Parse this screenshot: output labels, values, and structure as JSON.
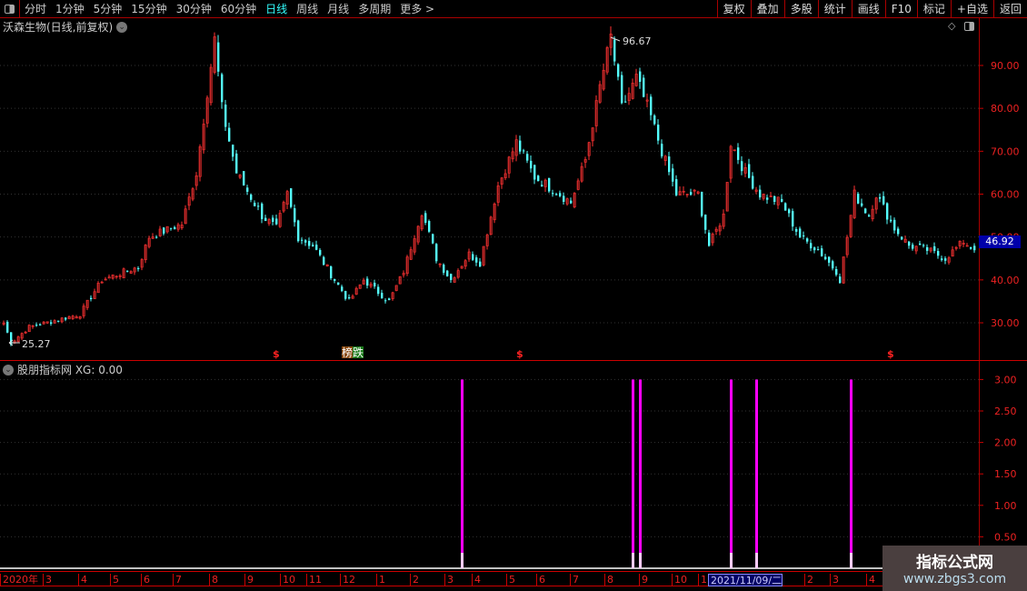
{
  "toolbar": {
    "periods": [
      "分时",
      "1分钟",
      "5分钟",
      "15分钟",
      "30分钟",
      "60分钟",
      "日线",
      "周线",
      "月线",
      "多周期",
      "更多 >"
    ],
    "active": "日线",
    "right_buttons": [
      "复权",
      "叠加",
      "多股",
      "统计",
      "画线",
      "F10",
      "标记",
      "+自选",
      "返回"
    ]
  },
  "stock_title": "沃森生物(日线,前复权)",
  "indicator_title": "股朋指标网 XG: 0.00",
  "last_price_label": "46.92",
  "high_label": "96.67",
  "low_label": "25.27",
  "markers": {
    "drop_label": "榜跌",
    "dollar": "$"
  },
  "watermark": {
    "line1": "指标公式网",
    "line2": "www.zbgs3.com"
  },
  "x_axis_labels": [
    "2020年",
    "3",
    "4",
    "5",
    "6",
    "7",
    "8",
    "9",
    "10",
    "11",
    "12",
    "1",
    "2",
    "3",
    "4",
    "5",
    "6",
    "7",
    "8",
    "9",
    "10",
    "1",
    "2021/11/09/二",
    "2",
    "3",
    "4"
  ],
  "colors": {
    "up": "#ff3232",
    "down": "#54ffff",
    "signal": "#ff00ff",
    "axis": "#cc0000"
  },
  "chart_data": [
    {
      "type": "candlestick",
      "title": "沃森生物(日线,前复权)",
      "y_ticks": [
        "90.00",
        "80.00",
        "70.00",
        "60.00",
        "50.00",
        "40.00",
        "30.00"
      ],
      "ylim": [
        21,
        99
      ],
      "close_keypoints": [
        [
          1,
          30
        ],
        [
          3,
          25.3
        ],
        [
          8,
          29
        ],
        [
          22,
          32
        ],
        [
          28,
          40
        ],
        [
          38,
          43
        ],
        [
          41,
          50
        ],
        [
          50,
          53
        ],
        [
          54,
          65
        ],
        [
          59,
          96
        ],
        [
          61,
          80
        ],
        [
          65,
          65
        ],
        [
          72,
          55
        ],
        [
          76,
          52
        ],
        [
          79,
          60
        ],
        [
          82,
          50
        ],
        [
          86,
          48
        ],
        [
          92,
          40
        ],
        [
          96,
          35
        ],
        [
          100,
          40
        ],
        [
          107,
          35
        ],
        [
          111,
          42
        ],
        [
          116,
          56
        ],
        [
          120,
          45
        ],
        [
          124,
          40
        ],
        [
          129,
          46
        ],
        [
          132,
          44
        ],
        [
          137,
          62
        ],
        [
          142,
          72
        ],
        [
          147,
          64
        ],
        [
          154,
          60
        ],
        [
          157,
          58
        ],
        [
          161,
          68
        ],
        [
          165,
          85
        ],
        [
          168,
          96.67
        ],
        [
          171,
          80
        ],
        [
          175,
          87
        ],
        [
          179,
          78
        ],
        [
          182,
          70
        ],
        [
          186,
          60
        ],
        [
          192,
          60
        ],
        [
          195,
          48
        ],
        [
          199,
          55
        ],
        [
          201,
          72
        ],
        [
          205,
          65
        ],
        [
          209,
          60
        ],
        [
          215,
          58
        ],
        [
          220,
          50
        ],
        [
          225,
          47
        ],
        [
          230,
          42
        ],
        [
          231,
          40
        ],
        [
          235,
          60
        ],
        [
          239,
          55
        ],
        [
          241,
          60
        ],
        [
          246,
          52
        ],
        [
          250,
          48
        ],
        [
          255,
          47
        ],
        [
          260,
          45
        ],
        [
          265,
          49
        ],
        [
          268,
          46.92
        ]
      ]
    },
    {
      "type": "bar",
      "title": "股朋指标网 XG",
      "y_ticks": [
        "3.00",
        "2.50",
        "2.00",
        "1.50",
        "1.00",
        "0.50"
      ],
      "ylim": [
        0,
        3.1
      ],
      "signals": [
        {
          "index": 126,
          "value": 3
        },
        {
          "index": 173,
          "value": 3
        },
        {
          "index": 175,
          "value": 3
        },
        {
          "index": 200,
          "value": 3
        },
        {
          "index": 207,
          "value": 3
        },
        {
          "index": 233,
          "value": 3
        }
      ],
      "markers": [
        {
          "index": 75,
          "label": "$"
        },
        {
          "index": 96,
          "label": "榜跌"
        },
        {
          "index": 142,
          "label": "$"
        },
        {
          "index": 244,
          "label": "$"
        }
      ]
    }
  ]
}
